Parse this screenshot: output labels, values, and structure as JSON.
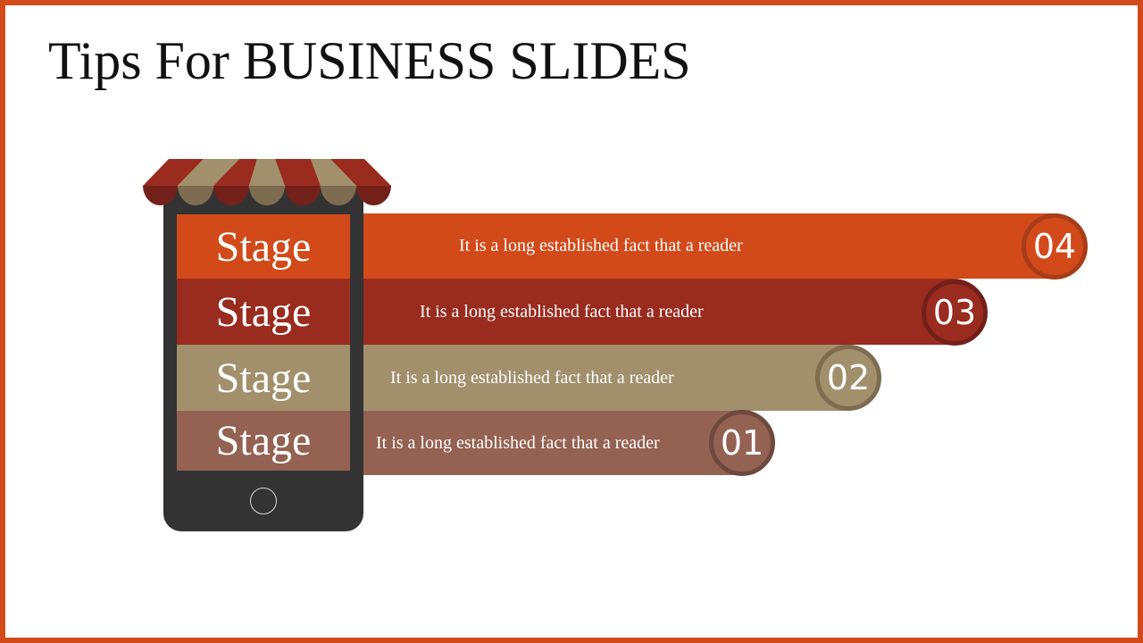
{
  "title": "Tips For BUSINESS SLIDES",
  "colors": {
    "frame": "#d24a1a",
    "stage4": "#d24a1a",
    "stage3": "#9a2b1f",
    "stage2": "#a28f6c",
    "stage1": "#946252",
    "phone": "#333333"
  },
  "stages": [
    {
      "label": "Stage",
      "number": "04",
      "text": "It is a long established fact that a reader"
    },
    {
      "label": "Stage",
      "number": "03",
      "text": "It is a long established fact that a reader"
    },
    {
      "label": "Stage",
      "number": "02",
      "text": "It is a long established fact that a reader"
    },
    {
      "label": "Stage",
      "number": "01",
      "text": "It is a long established fact that a reader"
    }
  ]
}
